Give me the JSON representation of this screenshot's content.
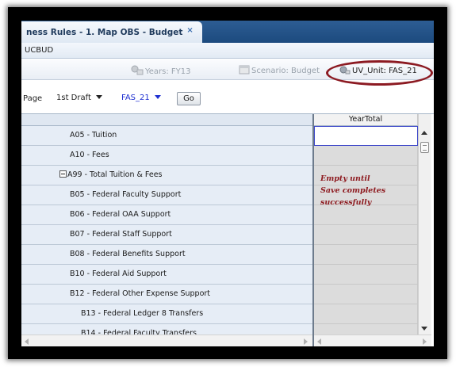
{
  "tab": {
    "title": "ness Rules - 1. Map OBS - Budget",
    "close": "×"
  },
  "subheader": {
    "text": "UCBUD"
  },
  "pov": {
    "years": "Years: FY13",
    "scenario": "Scenario: Budget",
    "unit": "UV_Unit: FAS_21"
  },
  "page": {
    "label": "Page",
    "version_value": "1st Draft",
    "unit_value": "FAS_21",
    "go_label": "Go"
  },
  "grid": {
    "column_header": "YearTotal",
    "rows": [
      {
        "label": "A05 - Tuition",
        "level": 1
      },
      {
        "label": "A10 - Fees",
        "level": 1
      },
      {
        "label": "A99 - Total Tuition & Fees",
        "level": 0,
        "expanded": true
      },
      {
        "label": "B05 - Federal Faculty Support",
        "level": 1
      },
      {
        "label": "B06 - Federal OAA Support",
        "level": 1
      },
      {
        "label": "B07 - Federal Staff Support",
        "level": 1
      },
      {
        "label": "B08 - Federal Benefits Support",
        "level": 1
      },
      {
        "label": "B10 - Federal Aid Support",
        "level": 1
      },
      {
        "label": "B12 - Federal Other Expense Support",
        "level": 1
      },
      {
        "label": "B13 - Federal Ledger 8 Transfers",
        "level": 2
      },
      {
        "label": "B14 - Federal Faculty Transfers",
        "level": 2
      }
    ]
  },
  "annotation": {
    "lines": [
      "Empty until",
      "Save completes",
      "successfully"
    ],
    "color": "#8e1b20"
  },
  "colors": {
    "tabbar": "#1c4a7e",
    "row_header_bg": "#e6edf6",
    "highlight_ellipse": "#8c1a22",
    "selected_cell_border": "#3d47c9"
  }
}
